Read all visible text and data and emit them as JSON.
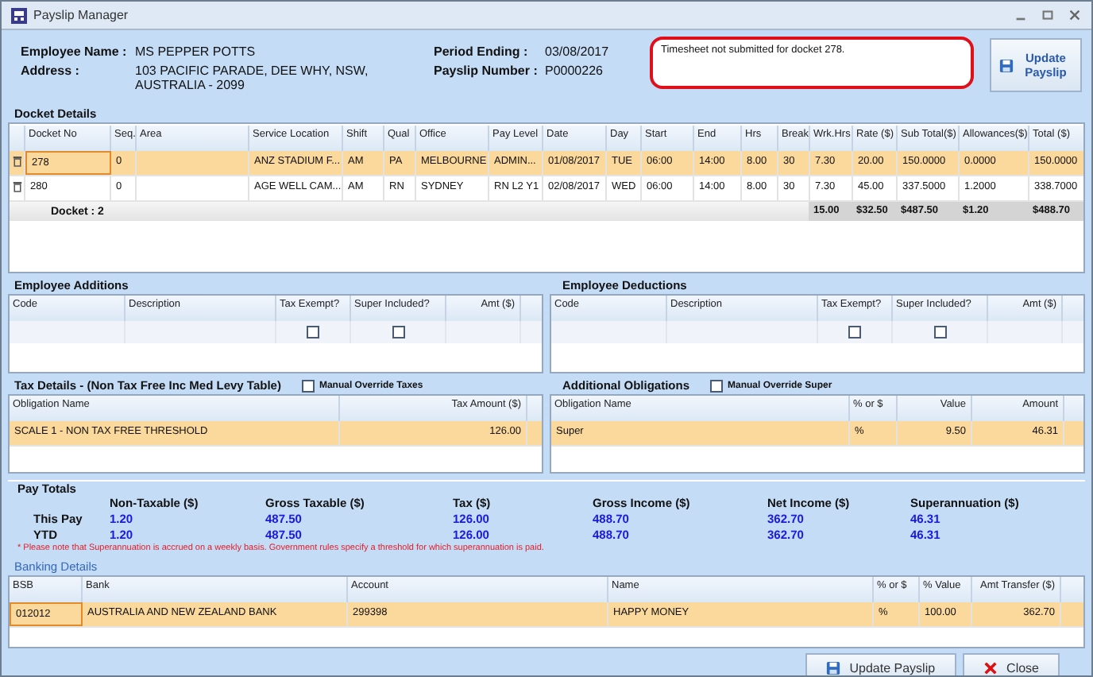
{
  "window": {
    "title": "Payslip Manager"
  },
  "employee": {
    "name_label": "Employee Name :",
    "name": "MS PEPPER POTTS",
    "address_label": "Address :",
    "address_lines": [
      "103 PACIFIC PARADE, DEE WHY, NSW,",
      "AUSTRALIA - 2099"
    ],
    "period_label": "Period Ending :",
    "period": "03/08/2017",
    "payslip_label": "Payslip Number :",
    "payslip": "P0000226"
  },
  "note": {
    "value": "Timesheet not submitted for docket 278."
  },
  "update_button": {
    "label": "Update Payslip"
  },
  "docket": {
    "title": "Docket Details",
    "columns": [
      "Docket No",
      "Seq.",
      "Area",
      "Service Location",
      "Shift",
      "Qual",
      "Office",
      "Pay Level",
      "Date",
      "Day",
      "Start",
      "End",
      "Hrs",
      "Break",
      "Wrk.Hrs",
      "Rate ($)",
      "Sub Total($)",
      "Allowances($)",
      "Total ($)"
    ],
    "rows": [
      {
        "selected": true,
        "cells": [
          "278",
          "0",
          null,
          "ANZ STADIUM F...",
          "AM",
          "PA",
          "MELBOURNE",
          "ADMIN...",
          "01/08/2017",
          "TUE",
          "06:00",
          "14:00",
          "8.00",
          "30",
          "7.30",
          "20.00",
          "150.0000",
          "0.0000",
          "150.0000"
        ]
      },
      {
        "selected": false,
        "cells": [
          "280",
          "0",
          null,
          "AGE WELL CAM...",
          "AM",
          "RN",
          "SYDNEY",
          "RN L2 Y1",
          "02/08/2017",
          "WED",
          "06:00",
          "14:00",
          "8.00",
          "30",
          "7.30",
          "45.00",
          "337.5000",
          "1.2000",
          "338.7000"
        ]
      }
    ],
    "total": {
      "label": "Docket : 2",
      "values": [
        "15.00",
        "$32.50",
        "$487.50",
        "$1.20",
        "$488.70"
      ]
    }
  },
  "additions": {
    "title": "Employee Additions",
    "columns": [
      "Code",
      "Description",
      "Tax Exempt?",
      "Super Included?",
      "Amt ($)"
    ],
    "rows": [
      {
        "tax_exempt": false,
        "super_included": false
      }
    ]
  },
  "deductions": {
    "title": "Employee Deductions",
    "columns": [
      "Code",
      "Description",
      "Tax Exempt?",
      "Super Included?",
      "Amt ($)"
    ],
    "rows": [
      {
        "tax_exempt": false,
        "super_included": false
      }
    ]
  },
  "tax": {
    "title": "Tax Details - (Non Tax Free Inc Med Levy Table)",
    "override": {
      "label": "Manual Override Taxes",
      "checked": false
    },
    "columns": [
      "Obligation Name",
      "Tax Amount ($)"
    ],
    "rows": [
      {
        "selected": true,
        "cells": [
          "SCALE 1 - NON TAX FREE THRESHOLD",
          "126.00"
        ]
      }
    ]
  },
  "obligations": {
    "title": "Additional Obligations",
    "override": {
      "label": "Manual Override Super",
      "checked": false
    },
    "columns": [
      "Obligation Name",
      "% or $",
      "Value",
      "Amount"
    ],
    "rows": [
      {
        "selected": true,
        "cells": [
          "Super",
          "%",
          "9.50",
          "46.31"
        ]
      }
    ]
  },
  "pay_totals": {
    "title": "Pay Totals",
    "columns": [
      "Non-Taxable ($)",
      "Gross Taxable ($)",
      "Tax ($)",
      "Gross Income ($)",
      "Net Income ($)",
      "Superannuation ($)"
    ],
    "rows": [
      {
        "label": "This Pay",
        "values": [
          "1.20",
          "487.50",
          "126.00",
          "488.70",
          "362.70",
          "46.31"
        ]
      },
      {
        "label": "YTD",
        "values": [
          "1.20",
          "487.50",
          "126.00",
          "488.70",
          "362.70",
          "46.31"
        ]
      }
    ],
    "note": "* Please note that Superannuation is accrued on a weekly basis. Government rules specify a threshold for which superannuation is paid."
  },
  "banking": {
    "title": "Banking Details",
    "columns": [
      "BSB",
      "Bank",
      "Account",
      "Name",
      "% or $",
      "% Value",
      "Amt Transfer ($)"
    ],
    "rows": [
      {
        "selected": true,
        "cells": [
          "012012",
          "AUSTRALIA AND NEW ZEALAND BANK",
          "299398",
          "HAPPY MONEY",
          "%",
          "100.00",
          "362.70"
        ]
      }
    ]
  },
  "footer_buttons": [
    {
      "kind": "save",
      "label": "Update Payslip"
    },
    {
      "kind": "close",
      "label": "Close"
    }
  ]
}
